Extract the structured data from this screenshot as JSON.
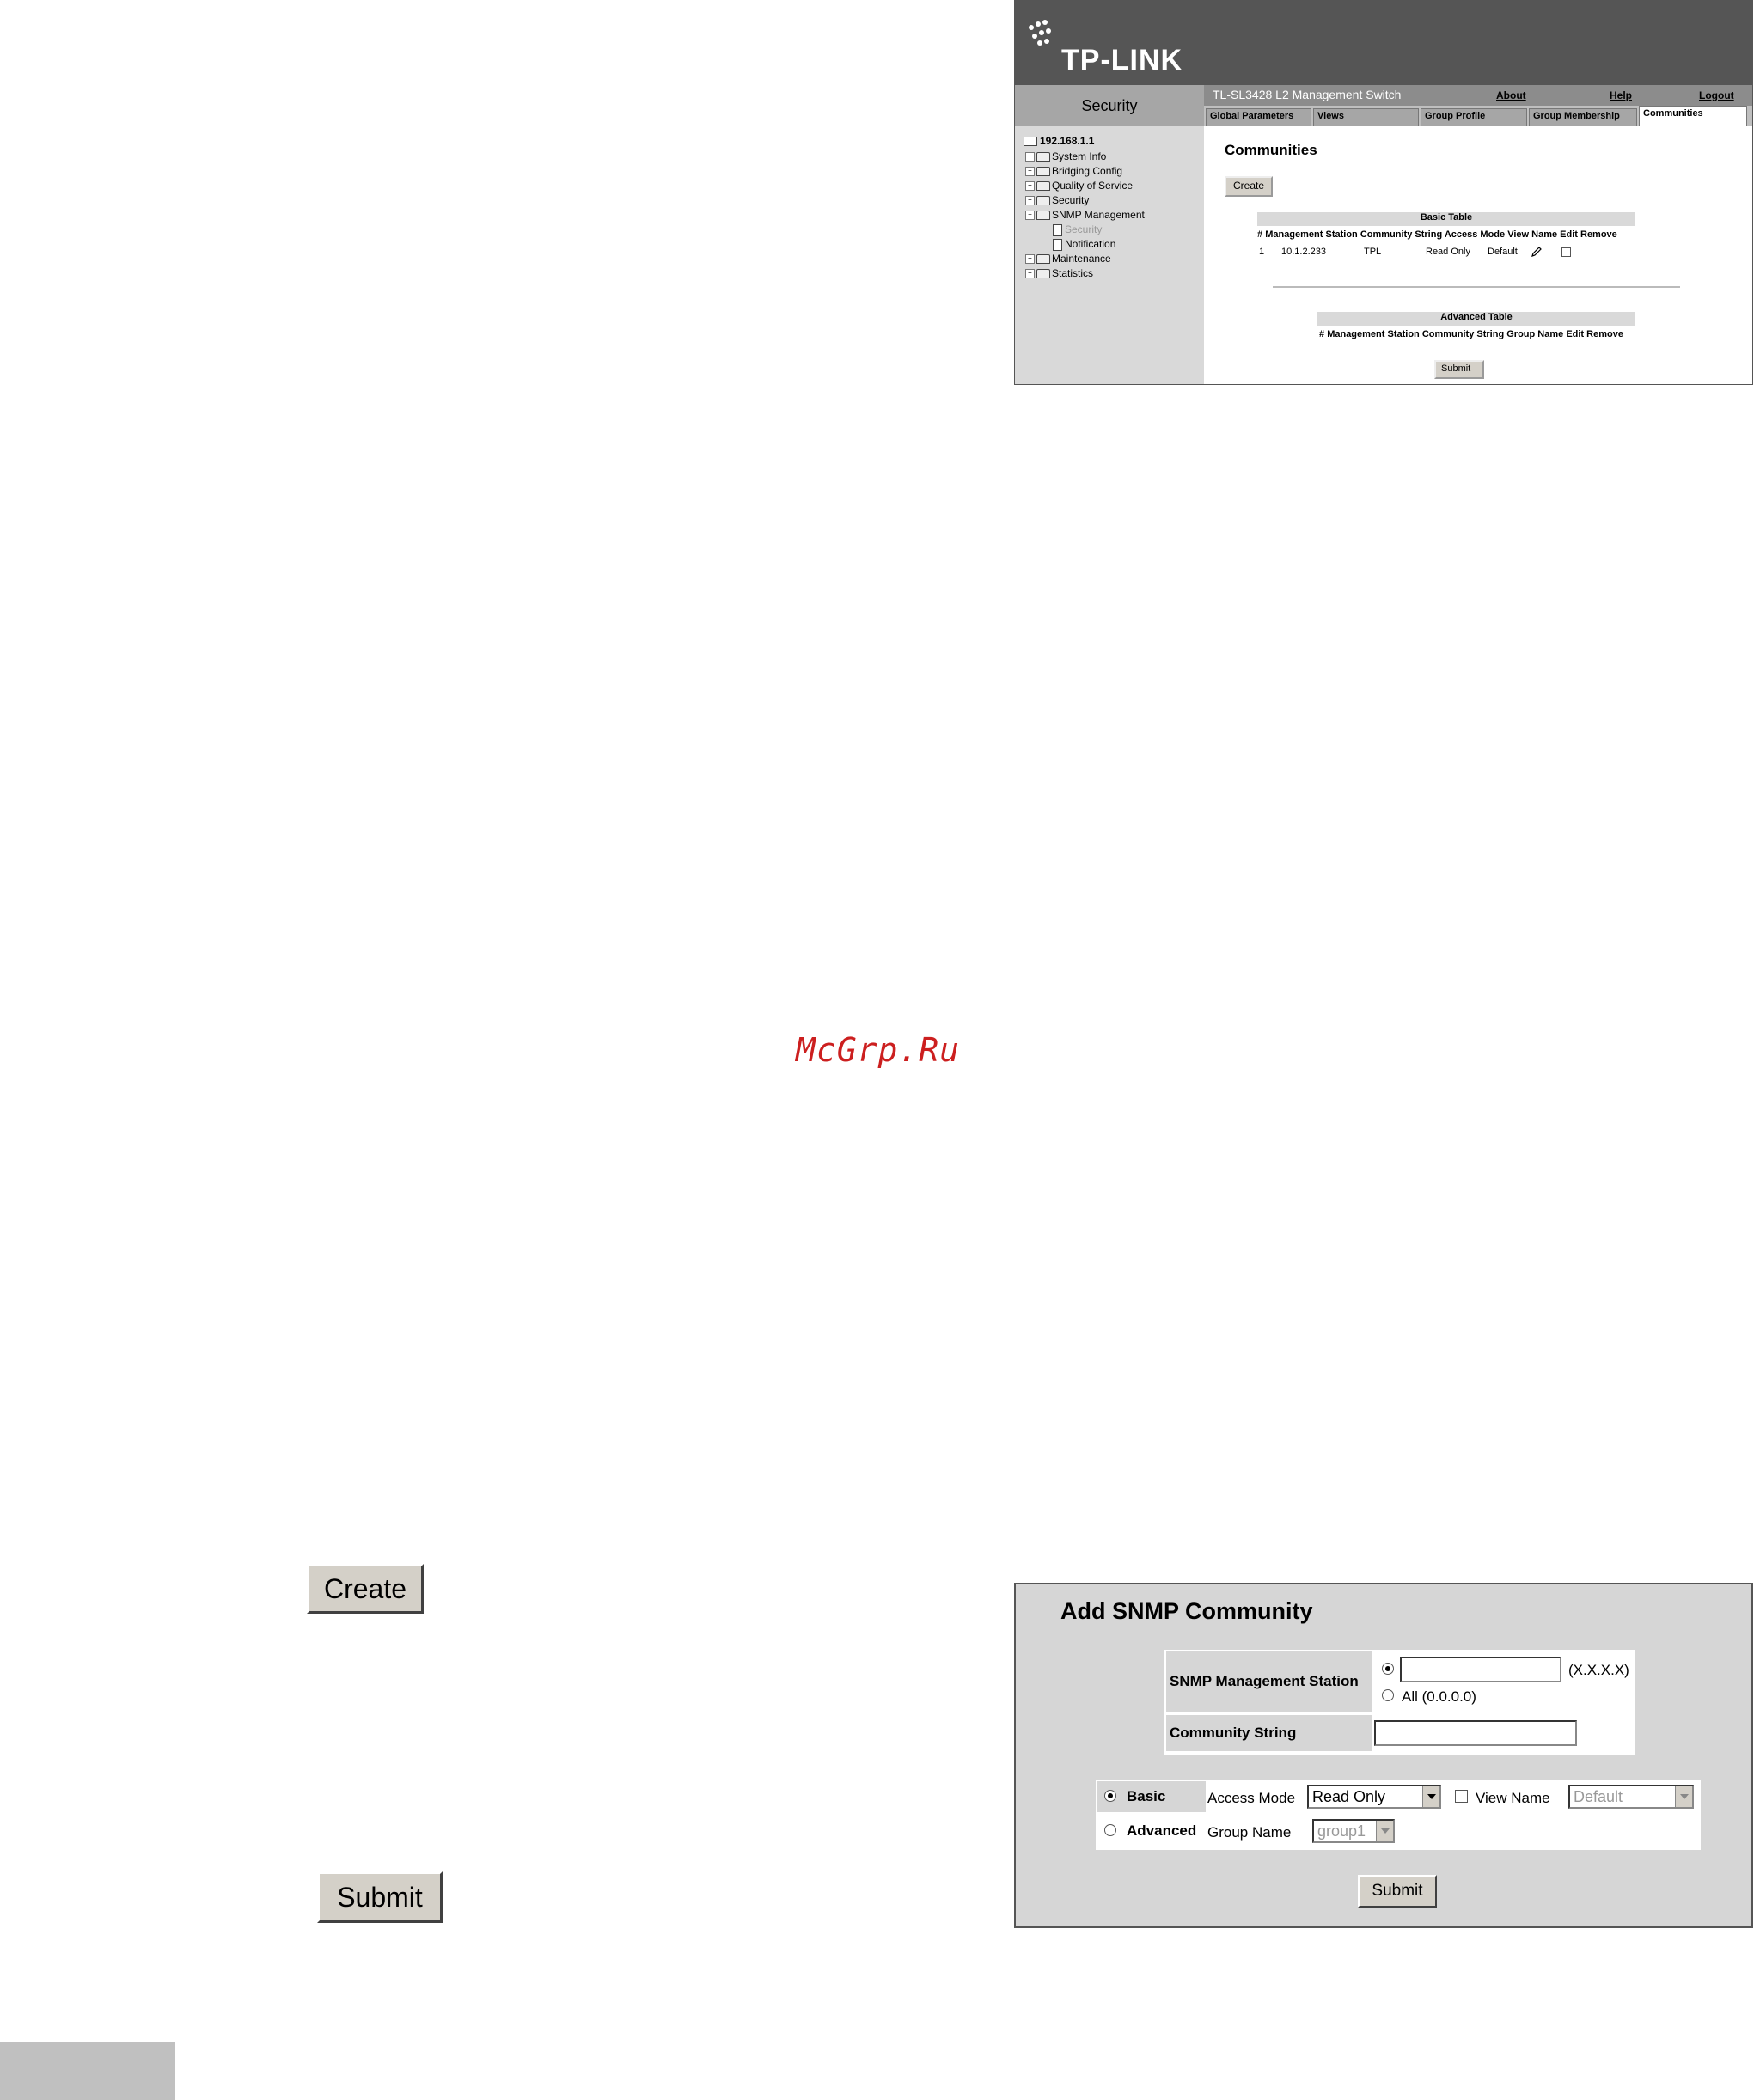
{
  "top_screenshot": {
    "brand": "TP-LINK",
    "section": "Security",
    "device_title": "TL-SL3428 L2 Management Switch",
    "links": {
      "about": "About",
      "help": "Help",
      "logout": "Logout"
    },
    "tabs": [
      "Global Parameters",
      "Views",
      "Group Profile",
      "Group Membership",
      "Communities"
    ],
    "active_tab": "Communities",
    "tree": {
      "root": "192.168.1.1",
      "items": [
        "System Info",
        "Bridging Config",
        "Quality of Service",
        "Security",
        "SNMP Management",
        "Maintenance",
        "Statistics"
      ],
      "snmp_children": [
        "Security",
        "Notification"
      ]
    },
    "page_title": "Communities",
    "create_label": "Create",
    "basic_table": {
      "title": "Basic Table",
      "columns": [
        "#",
        "Management Station",
        "Community String",
        "Access Mode",
        "View Name",
        "Edit",
        "Remove"
      ],
      "row": {
        "num": "1",
        "station": "10.1.2.233",
        "community": "TPL",
        "access": "Read Only",
        "view": "Default"
      }
    },
    "advanced_table": {
      "title": "Advanced Table",
      "columns": [
        "#",
        "Management Station",
        "Community String",
        "Group Name",
        "Edit",
        "Remove"
      ]
    },
    "submit_label": "Submit"
  },
  "watermark": "McGrp.Ru",
  "standalone_buttons": {
    "create": "Create",
    "submit": "Submit"
  },
  "bottom_screenshot": {
    "title": "Add SNMP Community",
    "snmp_station_label": "SNMP Management Station",
    "ip_hint": "(X.X.X.X)",
    "all_option": "All (0.0.0.0)",
    "community_label": "Community String",
    "basic_label": "Basic",
    "advanced_label": "Advanced",
    "access_mode_label": "Access Mode",
    "access_mode_value": "Read Only",
    "view_name_label": "View Name",
    "view_name_value": "Default",
    "group_name_label": "Group Name",
    "group_name_value": "group1",
    "submit_label": "Submit"
  }
}
